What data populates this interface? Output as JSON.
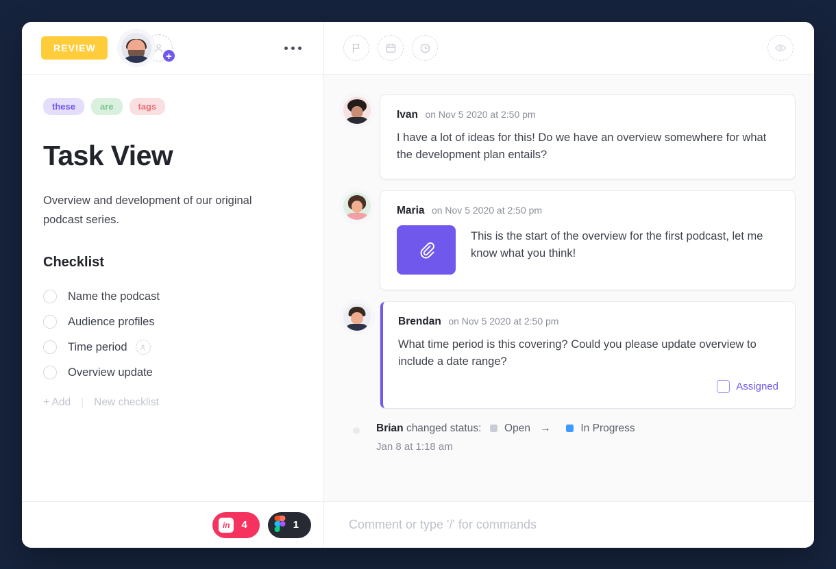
{
  "theme": {
    "page_background": "#16233c",
    "card_background": "#ffffff",
    "panel_background": "#fafafa",
    "accent_purple": "#7058ec",
    "review_yellow": "#ffcd3c",
    "invision_pink": "#f5335e",
    "figma_dark": "#272a33",
    "status_open": "#c9ccd4",
    "status_in_progress": "#3d9aff"
  },
  "header": {
    "status_badge": "REVIEW",
    "assignee_avatar_name": "avatar",
    "add_assignee_icon": "add-person-icon",
    "add_assignee_plus": "+",
    "more_menu_icon": "ellipsis-icon",
    "toolbar_icons": [
      {
        "name": "flag-icon",
        "label": "Priority"
      },
      {
        "name": "calendar-icon",
        "label": "Due date"
      },
      {
        "name": "clock-icon",
        "label": "Time estimate"
      }
    ],
    "watch_icon": "eye-icon"
  },
  "task": {
    "tags": [
      {
        "label": "these",
        "bg": "#e4defa",
        "color": "#7058ec"
      },
      {
        "label": "are",
        "bg": "#d9f0df",
        "color": "#7fc68f"
      },
      {
        "label": "tags",
        "bg": "#fadfe0",
        "color": "#e8727b"
      }
    ],
    "title": "Task View",
    "description": "Overview and development of our original podcast series."
  },
  "checklist": {
    "heading": "Checklist",
    "items": [
      {
        "label": "Name the podcast",
        "checked": false,
        "has_assignee": false
      },
      {
        "label": "Audience profiles",
        "checked": false,
        "has_assignee": false
      },
      {
        "label": "Time period",
        "checked": false,
        "has_assignee": true
      },
      {
        "label": "Overview update",
        "checked": false,
        "has_assignee": false
      }
    ],
    "add_label": "+ Add",
    "new_checklist_label": "New checklist"
  },
  "comments": [
    {
      "author": "Ivan",
      "time": "on Nov 5 2020 at 2:50 pm",
      "text": "I have a lot of ideas for this! Do we have an overview somewhere for what the development plan entails?",
      "highlighted": false,
      "has_attachment": false,
      "assigned_label": null
    },
    {
      "author": "Maria",
      "time": "on Nov 5 2020 at 2:50 pm",
      "text": "This is the start of the overview for the first podcast, let me know what you think!",
      "highlighted": false,
      "has_attachment": true,
      "attachment_icon": "paperclip-icon",
      "assigned_label": null
    },
    {
      "author": "Brendan",
      "time": "on Nov 5 2020 at 2:50 pm",
      "text": "What time period is this covering? Could you please update overview to include a date range?",
      "highlighted": true,
      "has_attachment": false,
      "assigned_label": "Assigned"
    }
  ],
  "activity": {
    "actor": "Brian",
    "action": "changed status:",
    "from_status": "Open",
    "arrow": "→",
    "to_status": "In Progress",
    "timestamp": "Jan 8 at 1:18 am"
  },
  "footer": {
    "integrations": [
      {
        "name": "invision",
        "logo_text": "in",
        "count": "4"
      },
      {
        "name": "figma",
        "logo_text": "figma-logo",
        "count": "1"
      }
    ],
    "comment_placeholder": "Comment or type '/' for commands",
    "comment_value": ""
  }
}
